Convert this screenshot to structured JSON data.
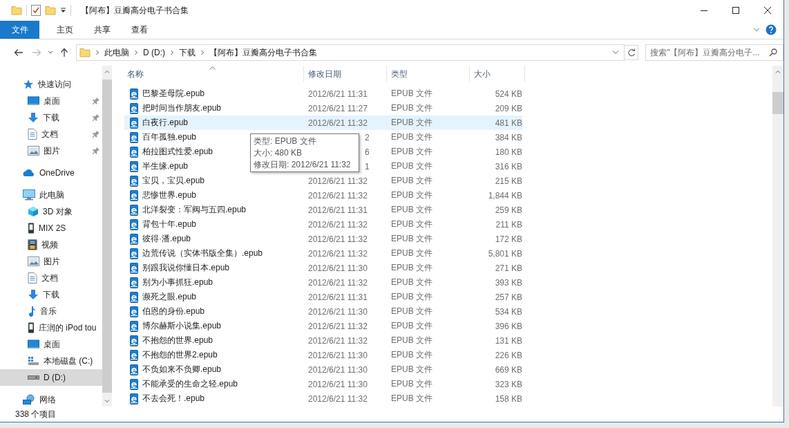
{
  "window": {
    "title": "【阿布】豆瓣高分电子书合集"
  },
  "ribbon": {
    "tabs": [
      {
        "label": "文件",
        "kind": "file"
      },
      {
        "label": "主页",
        "kind": "tab"
      },
      {
        "label": "共享",
        "kind": "tab"
      },
      {
        "label": "查看",
        "kind": "tab"
      }
    ]
  },
  "address_bar": {
    "forward_disabled": true,
    "path": [
      "此电脑",
      "D (D:)",
      "下载",
      "【阿布】豆瓣高分电子书合集"
    ]
  },
  "search": {
    "placeholder": "搜索\"【阿布】豆瓣高分电子..."
  },
  "sidebar": {
    "items": [
      {
        "label": "快速访问",
        "kind": "star",
        "selected": false,
        "children": [
          {
            "label": "桌面",
            "kind": "desktop",
            "pinned": true,
            "selected": false
          },
          {
            "label": "下载",
            "kind": "download",
            "pinned": true,
            "selected": false
          },
          {
            "label": "文档",
            "kind": "document",
            "pinned": true,
            "selected": false
          },
          {
            "label": "图片",
            "kind": "picture",
            "pinned": true,
            "selected": false
          }
        ]
      },
      {
        "label": "OneDrive",
        "kind": "cloud",
        "selected": false
      },
      {
        "label": "此电脑",
        "kind": "computer",
        "selected": false,
        "children": [
          {
            "label": "3D 对象",
            "kind": "cube",
            "selected": false
          },
          {
            "label": "MIX 2S",
            "kind": "phone",
            "selected": false
          },
          {
            "label": "视频",
            "kind": "film",
            "selected": false
          },
          {
            "label": "图片",
            "kind": "picture",
            "selected": false
          },
          {
            "label": "文档",
            "kind": "document",
            "selected": false
          },
          {
            "label": "下载",
            "kind": "download",
            "selected": false
          },
          {
            "label": "音乐",
            "kind": "music",
            "selected": false
          },
          {
            "label": "庄润的 iPod tou",
            "kind": "phone",
            "selected": false
          },
          {
            "label": "桌面",
            "kind": "desktop",
            "selected": false
          },
          {
            "label": "本地磁盘 (C:)",
            "kind": "systemdisk",
            "selected": false
          },
          {
            "label": "D (D:)",
            "kind": "disk",
            "selected": true
          }
        ]
      },
      {
        "label": "网络",
        "kind": "network",
        "selected": false
      }
    ]
  },
  "table": {
    "columns": [
      {
        "label": "名称",
        "sorted": true
      },
      {
        "label": "修改日期",
        "sorted": false
      },
      {
        "label": "类型",
        "sorted": false
      },
      {
        "label": "大小",
        "sorted": false
      }
    ],
    "rows": [
      {
        "name": "巴黎圣母院.epub",
        "date": "2012/6/21 11:31",
        "type": "EPUB 文件",
        "size": "524 KB",
        "selected": false
      },
      {
        "name": "把时间当作朋友.epub",
        "date": "2012/6/21 11:27",
        "type": "EPUB 文件",
        "size": "209 KB",
        "selected": false
      },
      {
        "name": "白夜行.epub",
        "date": "2012/6/21 11:32",
        "type": "EPUB 文件",
        "size": "481 KB",
        "selected": true
      },
      {
        "name": "百年孤独.epub",
        "date": "2",
        "date_covered": true,
        "type": "EPUB 文件",
        "size": "384 KB",
        "selected": false
      },
      {
        "name": "柏拉图式性爱.epub",
        "date": "6",
        "date_covered": true,
        "type": "EPUB 文件",
        "size": "180 KB",
        "selected": false
      },
      {
        "name": "半生缘.epub",
        "date": "1",
        "date_covered": true,
        "type": "EPUB 文件",
        "size": "316 KB",
        "selected": false
      },
      {
        "name": "宝贝，宝贝.epub",
        "date": "2012/6/21 11:32",
        "type": "EPUB 文件",
        "size": "215 KB",
        "selected": false
      },
      {
        "name": "悲惨世界.epub",
        "date": "2012/6/21 11:32",
        "type": "EPUB 文件",
        "size": "1,844 KB",
        "selected": false
      },
      {
        "name": "北洋裂变：军阀与五四.epub",
        "date": "2012/6/21 11:31",
        "type": "EPUB 文件",
        "size": "259 KB",
        "selected": false
      },
      {
        "name": "背包十年.epub",
        "date": "2012/6/21 11:32",
        "type": "EPUB 文件",
        "size": "211 KB",
        "selected": false
      },
      {
        "name": "彼得·潘.epub",
        "date": "2012/6/21 11:32",
        "type": "EPUB 文件",
        "size": "172 KB",
        "selected": false
      },
      {
        "name": "边荒传说（实体书版全集）.epub",
        "date": "2012/6/21 11:32",
        "type": "EPUB 文件",
        "size": "5,801 KB",
        "selected": false
      },
      {
        "name": "别跟我说你懂日本.epub",
        "date": "2012/6/21 11:30",
        "type": "EPUB 文件",
        "size": "271 KB",
        "selected": false
      },
      {
        "name": "别为小事抓狂.epub",
        "date": "2012/6/21 11:32",
        "type": "EPUB 文件",
        "size": "393 KB",
        "selected": false
      },
      {
        "name": "濒死之眼.epub",
        "date": "2012/6/21 11:31",
        "type": "EPUB 文件",
        "size": "257 KB",
        "selected": false
      },
      {
        "name": "伯恩的身份.epub",
        "date": "2012/6/21 11:30",
        "type": "EPUB 文件",
        "size": "534 KB",
        "selected": false
      },
      {
        "name": "博尔赫斯小说集.epub",
        "date": "2012/6/21 11:32",
        "type": "EPUB 文件",
        "size": "396 KB",
        "selected": false
      },
      {
        "name": "不抱怨的世界.epub",
        "date": "2012/6/21 11:32",
        "type": "EPUB 文件",
        "size": "131 KB",
        "selected": false
      },
      {
        "name": "不抱怨的世界2.epub",
        "date": "2012/6/21 11:30",
        "type": "EPUB 文件",
        "size": "226 KB",
        "selected": false
      },
      {
        "name": "不负如来不负卿.epub",
        "date": "2012/6/21 11:30",
        "type": "EPUB 文件",
        "size": "669 KB",
        "selected": false
      },
      {
        "name": "不能承受的生命之轻.epub",
        "date": "2012/6/21 11:30",
        "type": "EPUB 文件",
        "size": "323 KB",
        "selected": false
      },
      {
        "name": "不去会死！.epub",
        "date": "2012/6/21 11:32",
        "type": "EPUB 文件",
        "size": "158 KB",
        "selected": false
      }
    ]
  },
  "tooltip": {
    "lines": [
      "类型: EPUB 文件",
      "大小: 480 KB",
      "修改日期: 2012/6/21 11:32"
    ]
  },
  "status_bar": {
    "count": "338 个项目"
  }
}
